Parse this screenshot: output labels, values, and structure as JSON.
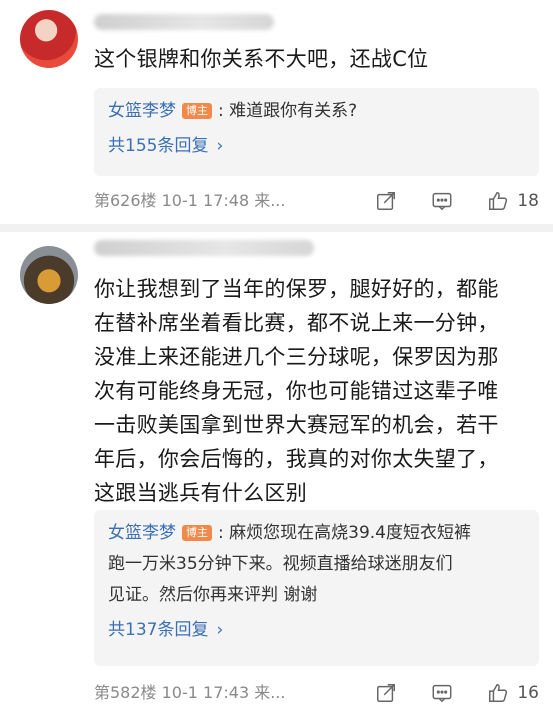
{
  "comments": [
    {
      "text": [
        "这个银牌和你关系不大吧，还战C位"
      ],
      "reply": {
        "author": "女篮李梦",
        "badge": "博主",
        "text": [
          ":  难道跟你有关系?"
        ],
        "count_label": "共155条回复"
      },
      "meta": "第626楼  10-1 17:48  来...",
      "likes": "18"
    },
    {
      "text": [
        "你让我想到了当年的保罗，腿好好的，都能",
        "在替补席坐着看比赛，都不说上来一分钟，",
        "没准上来还能进几个三分球呢，保罗因为那",
        "次有可能终身无冠，你也可能错过这辈子唯",
        "一击败美国拿到世界大赛冠军的机会，若干",
        "年后，你会后悔的，我真的对你太失望了，",
        "这跟当逃兵有什么区别"
      ],
      "reply": {
        "author": "女篮李梦",
        "badge": "博主",
        "text": [
          ": 麻烦您现在高烧39.4度短衣短裤",
          "跑一万米35分钟下来。视频直播给球迷朋友们",
          "见证。然后你再来评判   谢谢"
        ],
        "count_label": "共137条回复"
      },
      "meta": "第582楼  10-1 17:43  来...",
      "likes": "16"
    }
  ],
  "icons": {
    "chevron": "chevron-right-icon",
    "share": "share-icon",
    "comment": "comment-icon",
    "like": "thumbs-up-icon"
  },
  "colors": {
    "link": "#3b6fb6",
    "badge": "#f08a4b",
    "muted": "#8a8a8a"
  }
}
